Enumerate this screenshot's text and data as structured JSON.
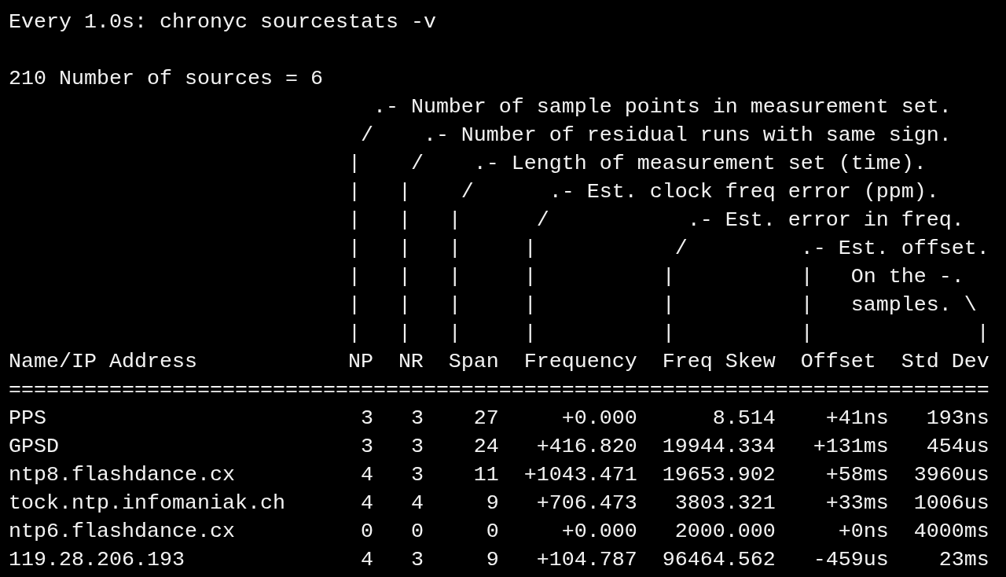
{
  "watch_header": "Every 1.0s: chronyc sourcestats -v",
  "summary": "210 Number of sources = 6",
  "legend": [
    "                             .- Number of sample points in measurement set.",
    "                            /    .- Number of residual runs with same sign.",
    "                           |    /    .- Length of measurement set (time).",
    "                           |   |    /      .- Est. clock freq error (ppm).",
    "                           |   |   |      /           .- Est. error in freq.",
    "                           |   |   |     |           /         .- Est. offset.",
    "                           |   |   |     |          |          |   On the -.",
    "                           |   |   |     |          |          |   samples. \\",
    "                           |   |   |     |          |          |             |"
  ],
  "table": {
    "columns": [
      "Name/IP Address",
      "NP",
      "NR",
      "Span",
      "Frequency",
      "Freq Skew",
      "Offset",
      "Std Dev"
    ],
    "separator": "==============================================================================",
    "rows": [
      [
        "PPS",
        "3",
        "3",
        "27",
        "+0.000",
        "8.514",
        "+41ns",
        "193ns"
      ],
      [
        "GPSD",
        "3",
        "3",
        "24",
        "+416.820",
        "19944.334",
        "+131ms",
        "454us"
      ],
      [
        "ntp8.flashdance.cx",
        "4",
        "3",
        "11",
        "+1043.471",
        "19653.902",
        "+58ms",
        "3960us"
      ],
      [
        "tock.ntp.infomaniak.ch",
        "4",
        "4",
        "9",
        "+706.473",
        "3803.321",
        "+33ms",
        "1006us"
      ],
      [
        "ntp6.flashdance.cx",
        "0",
        "0",
        "0",
        "+0.000",
        "2000.000",
        "+0ns",
        "4000ms"
      ],
      [
        "119.28.206.193",
        "4",
        "3",
        "9",
        "+104.787",
        "96464.562",
        "-459us",
        "23ms"
      ]
    ]
  }
}
